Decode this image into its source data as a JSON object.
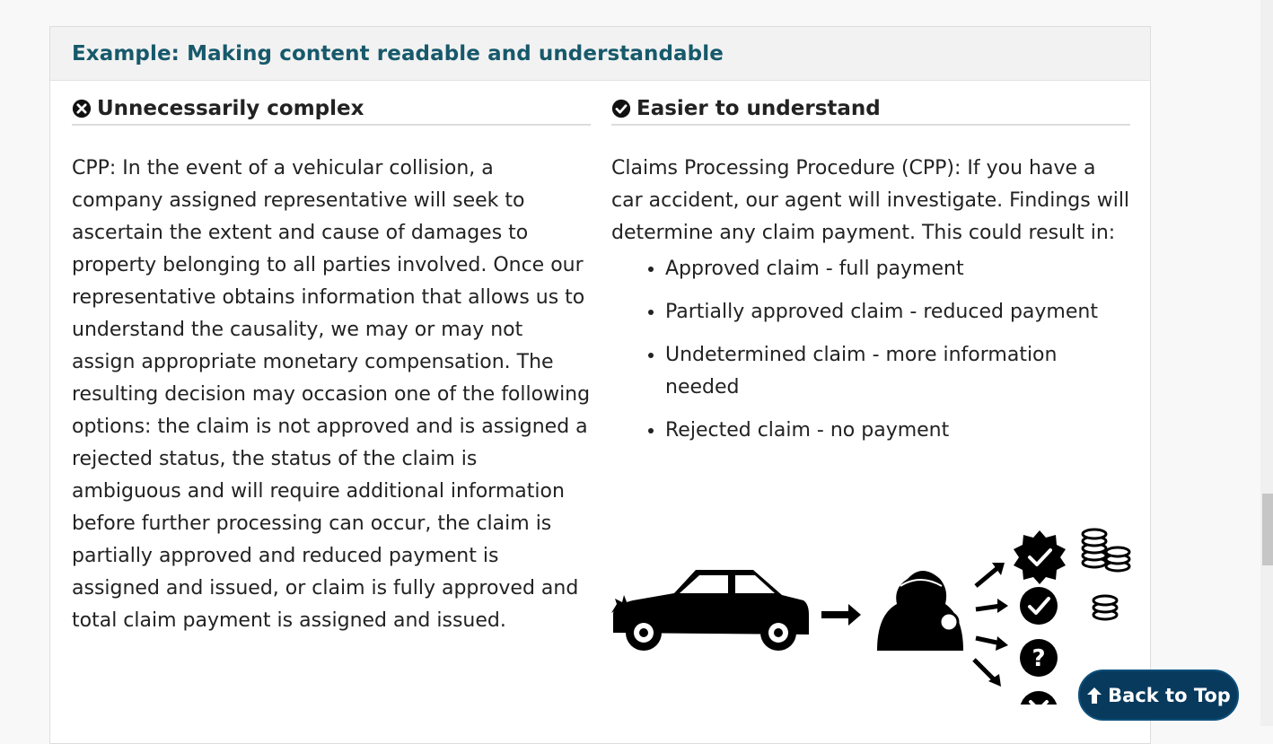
{
  "top_cut_text": "",
  "panel": {
    "title": "Example: Making content readable and understandable"
  },
  "left": {
    "icon": "x-circle-icon",
    "title": "Unnecessarily complex",
    "paragraph": "CPP: In the event of a vehicular collision, a company assigned representative will seek to ascertain the extent and cause of damages to property belonging to all parties involved. Once our representative obtains information that allows us to understand the causality, we may or may not assign appropriate monetary compensation. The resulting decision may occasion one of the following options: the claim is not approved and is assigned a rejected status, the status of the claim is ambiguous and will require additional information before further processing can occur, the claim is partially approved and reduced payment is assigned and issued, or claim is fully approved and total claim payment is assigned and issued."
  },
  "right": {
    "icon": "check-circle-icon",
    "title": "Easier to understand",
    "paragraph": "Claims Processing Procedure (CPP): If you have a car accident, our agent will investigate. Findings will determine any claim payment. This could result in:",
    "items": [
      "Approved claim - full payment",
      "Partially approved claim - reduced payment",
      "Undetermined claim - more information needed",
      "Rejected claim - no payment"
    ]
  },
  "illustration": {
    "icons": [
      "car-icon",
      "arrow-right-icon",
      "detective-icon",
      "verified-badge-icon",
      "check-circle-icon",
      "question-circle-icon",
      "x-circle-icon",
      "coins-stack-icon"
    ]
  },
  "back_to_top": {
    "label": "Back to Top",
    "icon": "arrow-up-icon"
  },
  "colors": {
    "title_teal": "#17596b",
    "button_navy": "#083a5e"
  }
}
